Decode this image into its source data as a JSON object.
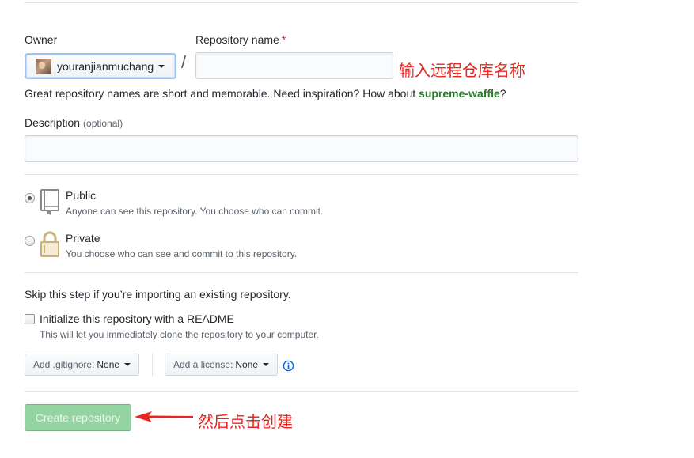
{
  "owner": {
    "label": "Owner",
    "username": "youranjianmuchang"
  },
  "repo_name": {
    "label": "Repository name",
    "required_marker": "*",
    "value": "",
    "separator": "/"
  },
  "annotations": {
    "repo_name_note": "输入远程仓库名称",
    "create_note": "然后点击创建",
    "color": "#e8251f"
  },
  "hint": {
    "prefix": "Great repository names are short and memorable. Need inspiration? How about",
    "suggestion": "supreme-waffle",
    "suffix": "?"
  },
  "description": {
    "label": "Description",
    "optional": "(optional)",
    "value": ""
  },
  "visibility": {
    "selected": "public",
    "public": {
      "title": "Public",
      "note": "Anyone can see this repository. You choose who can commit."
    },
    "private": {
      "title": "Private",
      "note": "You choose who can see and commit to this repository."
    }
  },
  "import_hint": "Skip this step if you’re importing an existing repository.",
  "readme": {
    "checked": false,
    "label": "Initialize this repository with a README",
    "note": "This will let you immediately clone the repository to your computer."
  },
  "gitignore": {
    "label": "Add .gitignore:",
    "value": "None"
  },
  "license": {
    "label": "Add a license:",
    "value": "None"
  },
  "create_button": {
    "label": "Create repository"
  },
  "colors": {
    "accent_green": "#2b7a2b",
    "create_button_bg": "#94d3a2",
    "info_blue": "#0366d6"
  }
}
